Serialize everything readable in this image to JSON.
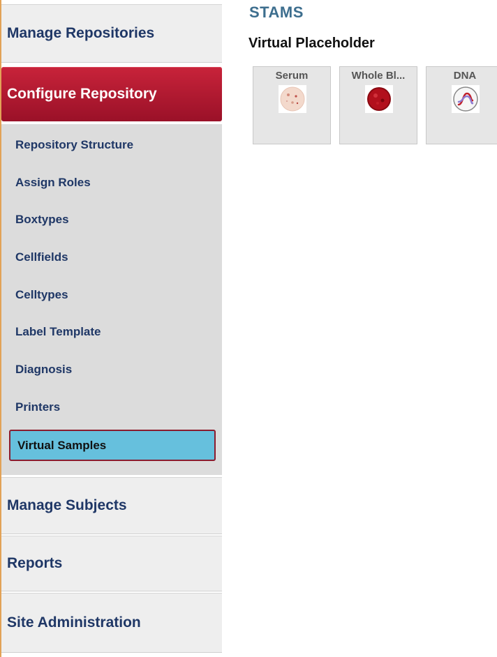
{
  "sidebar": {
    "manage_repositories": "Manage Repositories",
    "configure_repository": "Configure Repository",
    "sub_items": [
      "Repository Structure",
      "Assign Roles",
      "Boxtypes",
      "Cellfields",
      "Celltypes",
      "Label Template",
      "Diagnosis",
      "Printers",
      "Virtual Samples"
    ],
    "manage_subjects": "Manage Subjects",
    "reports": "Reports",
    "site_administration": "Site Administration"
  },
  "main": {
    "app_title": "STAMS",
    "section_title": "Virtual Placeholder",
    "tiles": [
      {
        "label": "Serum",
        "icon": "serum-icon"
      },
      {
        "label": "Whole Bl...",
        "icon": "whole-blood-icon"
      },
      {
        "label": "DNA",
        "icon": "dna-icon"
      }
    ]
  },
  "colors": {
    "active_nav": "#b01a30",
    "selected_sub_item": "#66c0dd",
    "nav_text": "#1f3766",
    "title": "#3d6e8e"
  }
}
